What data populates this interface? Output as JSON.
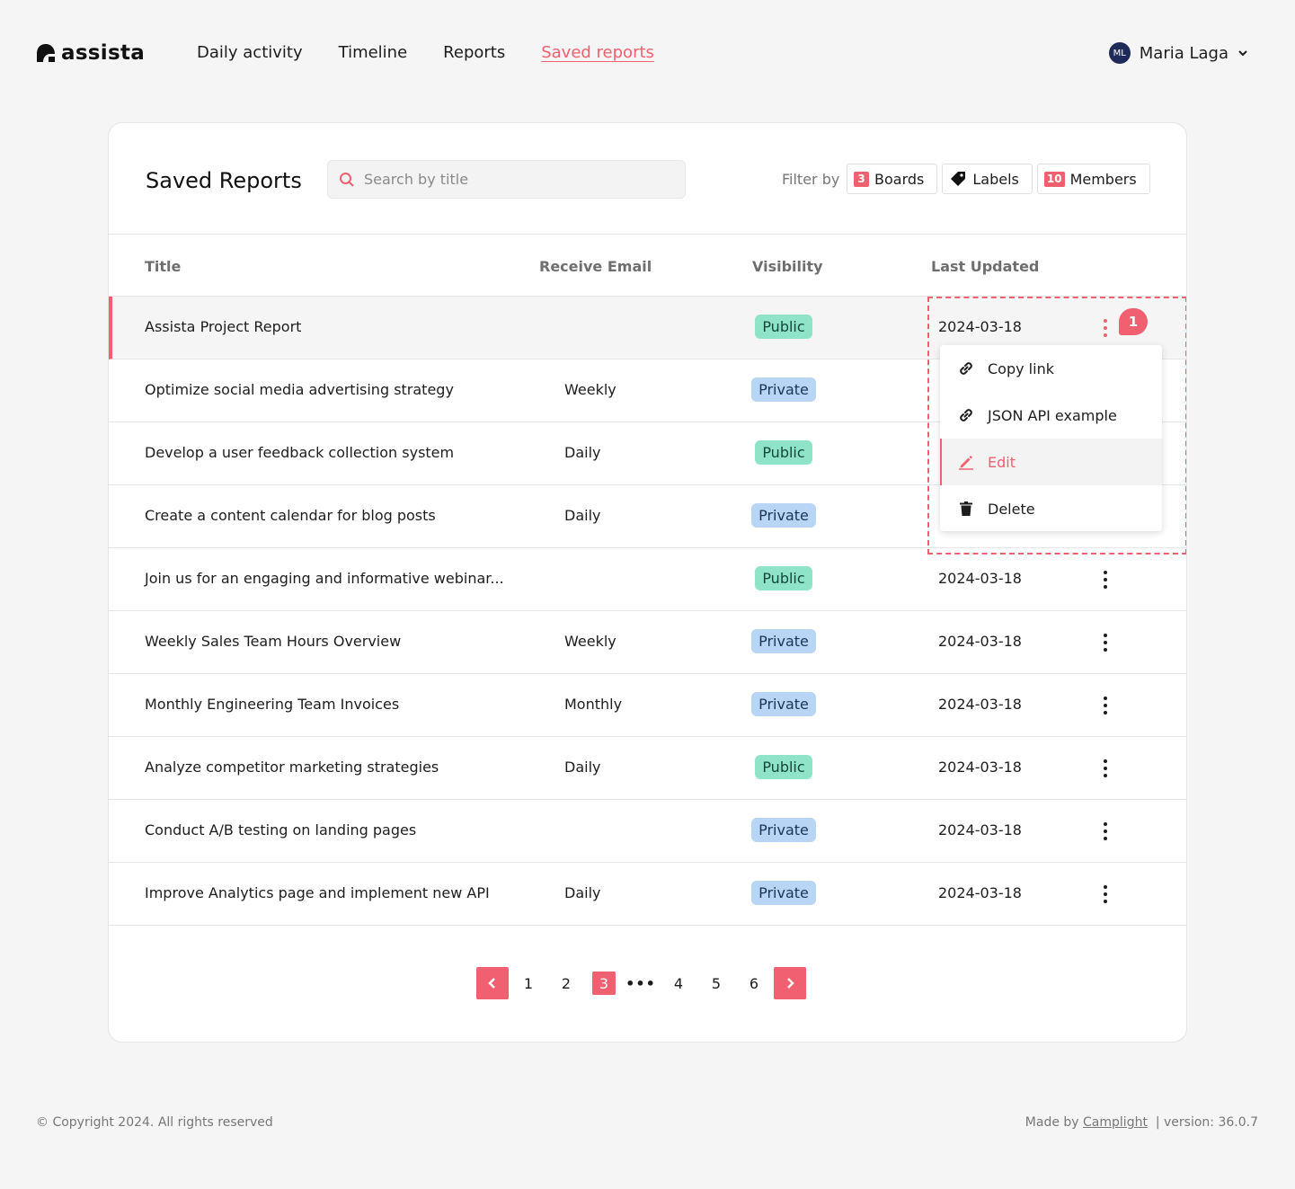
{
  "app": {
    "logo_text": "assista",
    "nav": [
      {
        "label": "Daily activity"
      },
      {
        "label": "Timeline"
      },
      {
        "label": "Reports"
      },
      {
        "label": "Saved reports"
      }
    ],
    "user": {
      "initials": "ML",
      "name": "Maria Laga"
    }
  },
  "page": {
    "title": "Saved Reports",
    "search_placeholder": "Search by title",
    "filter_label": "Filter by",
    "filters": [
      {
        "count": "3",
        "label": "Boards",
        "icon": "count-badge"
      },
      {
        "count": "",
        "label": "Labels",
        "icon": "tag-icon"
      },
      {
        "count": "10",
        "label": "Members",
        "icon": "count-badge"
      }
    ]
  },
  "table": {
    "columns": [
      "Title",
      "Receive Email",
      "Visibility",
      "Last Updated"
    ],
    "rows": [
      {
        "title": "Assista Project Report",
        "email": "",
        "visibility": "Public",
        "updated": "2024-03-18"
      },
      {
        "title": "Optimize social media advertising strategy",
        "email": "Weekly",
        "visibility": "Private",
        "updated": ""
      },
      {
        "title": "Develop a user feedback collection system",
        "email": "Daily",
        "visibility": "Public",
        "updated": ""
      },
      {
        "title": "Create a content calendar for blog posts",
        "email": "Daily",
        "visibility": "Private",
        "updated": ""
      },
      {
        "title": "Join us for an engaging and informative webinar...",
        "email": "",
        "visibility": "Public",
        "updated": "2024-03-18"
      },
      {
        "title": "Weekly Sales Team Hours Overview",
        "email": "Weekly",
        "visibility": "Private",
        "updated": "2024-03-18"
      },
      {
        "title": "Monthly Engineering Team Invoices",
        "email": "Monthly",
        "visibility": "Private",
        "updated": "2024-03-18"
      },
      {
        "title": "Analyze competitor marketing strategies",
        "email": "Daily",
        "visibility": "Public",
        "updated": "2024-03-18"
      },
      {
        "title": "Conduct A/B testing on landing pages",
        "email": "",
        "visibility": "Private",
        "updated": "2024-03-18"
      },
      {
        "title": "Improve Analytics page and implement new API",
        "email": "Daily",
        "visibility": "Private",
        "updated": "2024-03-18"
      }
    ]
  },
  "menu": {
    "badge": "1",
    "items": [
      {
        "label": "Copy link",
        "icon": "link-icon"
      },
      {
        "label": "JSON API example",
        "icon": "link-icon"
      },
      {
        "label": "Edit",
        "icon": "pencil-icon"
      },
      {
        "label": "Delete",
        "icon": "trash-icon"
      }
    ]
  },
  "pagination": {
    "pages": [
      "1",
      "2",
      "3",
      "•••",
      "4",
      "5",
      "6"
    ],
    "current": "3"
  },
  "footer": {
    "copyright": "© Copyright 2024. All rights reserved",
    "made_by": "Made by",
    "made_by_link": "Camplight",
    "version": "| version: 36.0.7"
  },
  "colors": {
    "accent": "#f06070",
    "public_pill": "#8fe3c9",
    "private_pill": "#b9d5f6"
  }
}
